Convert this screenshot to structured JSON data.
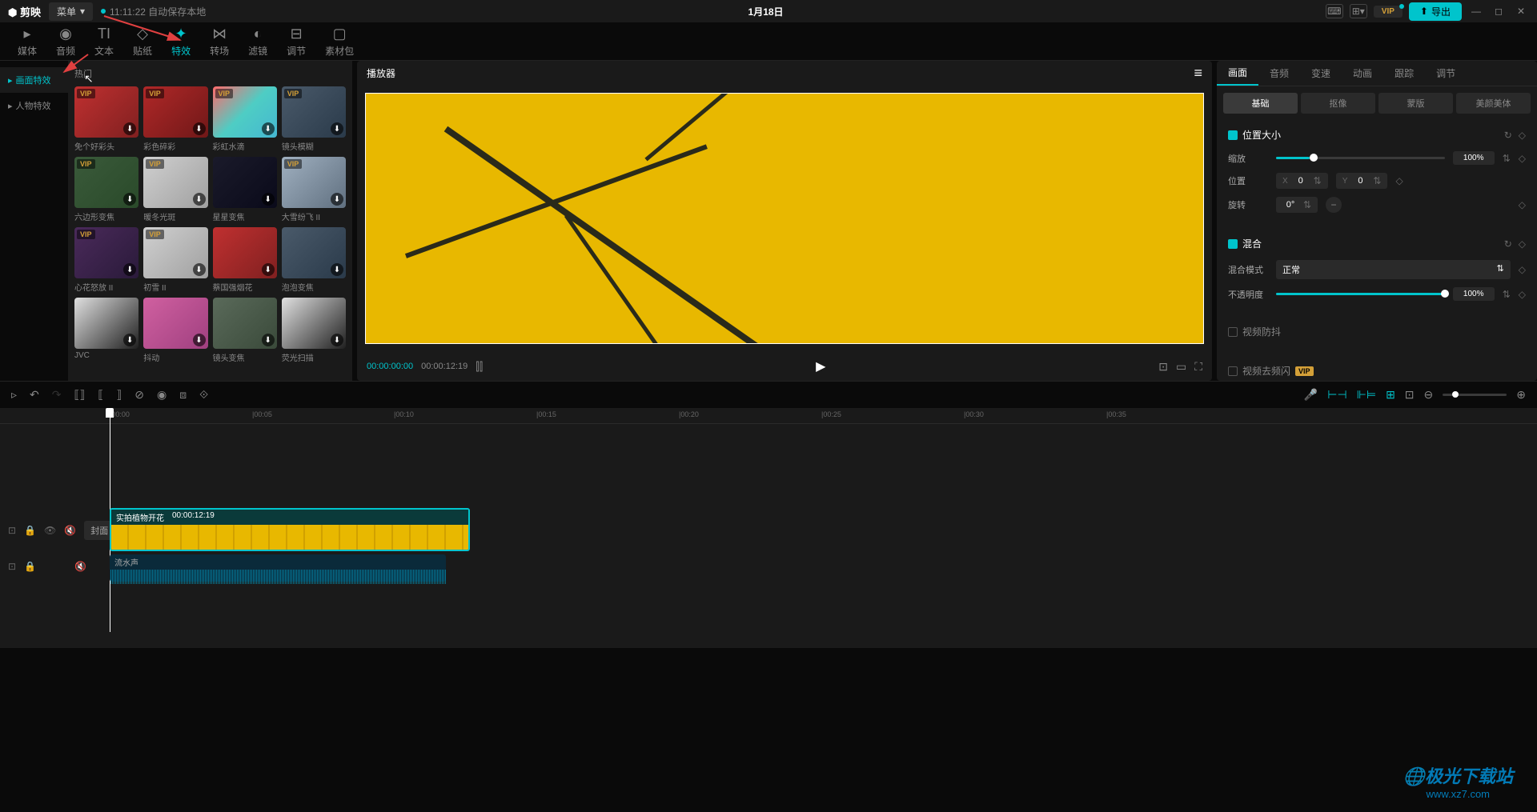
{
  "titlebar": {
    "app_name": "剪映",
    "menu": "菜单",
    "autosave": "11:11:22 自动保存本地",
    "project_name": "1月18日",
    "vip": "VIP",
    "export": "导出"
  },
  "toolbar": {
    "items": [
      {
        "label": "媒体",
        "icon": "▸"
      },
      {
        "label": "音频",
        "icon": "◉"
      },
      {
        "label": "文本",
        "icon": "TI"
      },
      {
        "label": "贴纸",
        "icon": "◇"
      },
      {
        "label": "特效",
        "icon": "✦"
      },
      {
        "label": "转场",
        "icon": "⋈"
      },
      {
        "label": "滤镜",
        "icon": "◐"
      },
      {
        "label": "调节",
        "icon": "⊟"
      },
      {
        "label": "素材包",
        "icon": "▢"
      }
    ]
  },
  "effects": {
    "categories": [
      {
        "label": "画面特效",
        "active": true
      },
      {
        "label": "人物特效",
        "active": false
      }
    ],
    "section": "热门",
    "items": [
      {
        "name": "免个好彩头",
        "vip": true,
        "cls": "th-red"
      },
      {
        "name": "彩色碎彩",
        "vip": true,
        "cls": "th-red2"
      },
      {
        "name": "彩虹水滴",
        "vip": true,
        "cls": "th-rainbow"
      },
      {
        "name": "镜头模糊",
        "vip": true,
        "cls": "th-blur"
      },
      {
        "name": "六边形变焦",
        "vip": true,
        "cls": "th-green"
      },
      {
        "name": "暖冬光斑",
        "vip": true,
        "cls": "th-white"
      },
      {
        "name": "星星变焦",
        "vip": false,
        "cls": "th-dark"
      },
      {
        "name": "大雪纷飞 II",
        "vip": true,
        "cls": "th-snow"
      },
      {
        "name": "心花怒放 II",
        "vip": true,
        "cls": "th-purple"
      },
      {
        "name": "初雪 II",
        "vip": true,
        "cls": "th-white"
      },
      {
        "name": "蔡国强烟花",
        "vip": false,
        "cls": "th-red"
      },
      {
        "name": "泡泡变焦",
        "vip": false,
        "cls": "th-blur"
      },
      {
        "name": "JVC",
        "vip": false,
        "cls": "th-bw"
      },
      {
        "name": "抖动",
        "vip": false,
        "cls": "th-pink"
      },
      {
        "name": "镜头变焦",
        "vip": false,
        "cls": "th-fog"
      },
      {
        "name": "荧光扫描",
        "vip": false,
        "cls": "th-bw"
      }
    ]
  },
  "player": {
    "title": "播放器",
    "time_current": "00:00:00:00",
    "time_total": "00:00:12:19"
  },
  "props": {
    "tabs": [
      "画面",
      "音频",
      "变速",
      "动画",
      "跟踪",
      "调节"
    ],
    "subtabs": [
      "基础",
      "抠像",
      "蒙版",
      "美颜美体"
    ],
    "position_size": {
      "title": "位置大小",
      "scale_label": "缩放",
      "scale_value": "100%",
      "position_label": "位置",
      "x_label": "X",
      "x_value": "0",
      "y_label": "Y",
      "y_value": "0",
      "rotation_label": "旋转",
      "rotation_value": "0°"
    },
    "blend": {
      "title": "混合",
      "mode_label": "混合模式",
      "mode_value": "正常",
      "opacity_label": "不透明度",
      "opacity_value": "100%"
    },
    "stabilize": {
      "title": "视频防抖"
    },
    "flicker": {
      "title": "视频去频闪",
      "vip": "VIP"
    }
  },
  "timeline": {
    "ruler": [
      "|00:00",
      "|00:05",
      "|00:10",
      "|00:15",
      "|00:20",
      "|00:25",
      "|00:30",
      "|00:35"
    ],
    "cover_label": "封面",
    "clip": {
      "name": "实拍植物开花",
      "time": "00:00:12:19"
    },
    "audio": {
      "name": "流水声"
    }
  },
  "watermark": {
    "logo": "极光下载站",
    "url": "www.xz7.com"
  }
}
